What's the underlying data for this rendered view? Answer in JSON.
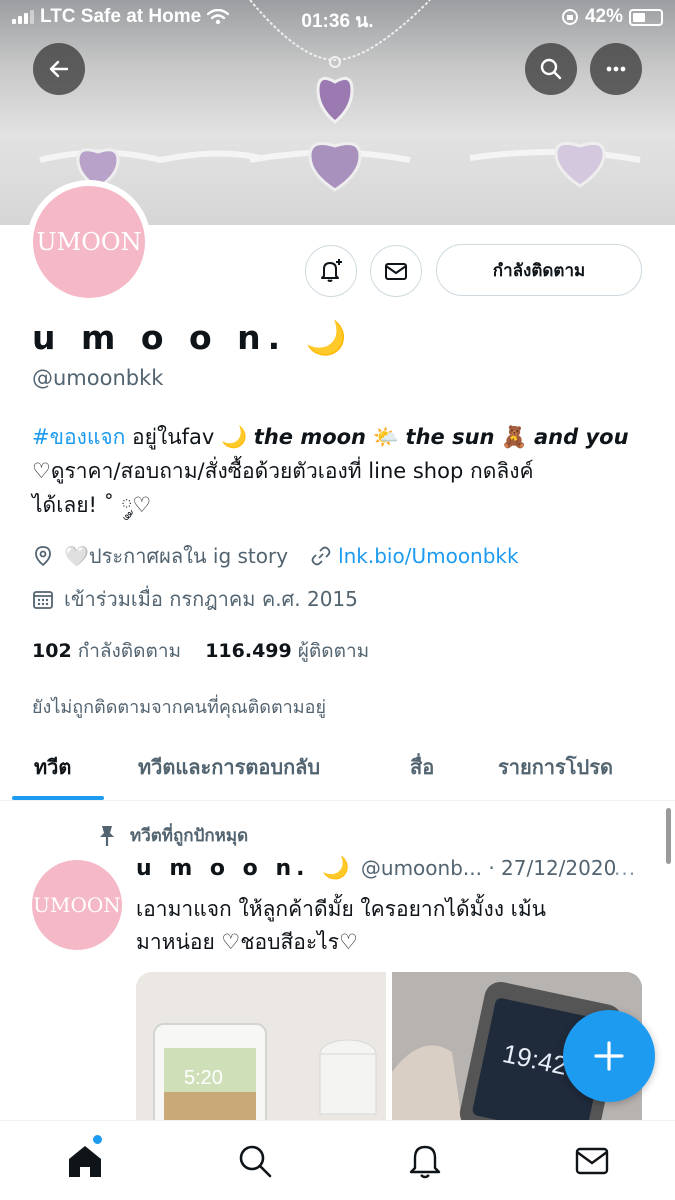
{
  "status_bar": {
    "carrier": "LTC Safe at Home",
    "time": "01:36 น.",
    "battery": "42%"
  },
  "profile": {
    "avatar_text": "UMOON",
    "name": "u m o o n. 🌙",
    "handle": "@umoonbkk",
    "follow_button": "กำลังติดตาม",
    "bio": {
      "hashtag": "#ของแจก",
      "line1_rest": " อยู่ในfav 🌙",
      "italic1": "the moon",
      "sun": " 🌤️",
      "italic2": "the sun",
      "bear": " 🧸",
      "italic3": "and you",
      "line2": "♡ดูราคา/สอบถาม/สั่งซื้อด้วยตัวเองที่ line shop กดลิงค์",
      "line3": "ได้เลย! ˚ ༘♡"
    },
    "location": "🤍ประกาศผลใน ig story",
    "website": "lnk.bio/Umoonbkk",
    "joined": "เข้าร่วมเมื่อ กรกฎาคม ค.ศ. 2015",
    "following_count": "102",
    "following_label": "กำลังติดตาม",
    "followers_count": "116.499",
    "followers_label": "ผู้ติดตาม",
    "not_followed_note": "ยังไม่ถูกติดตามจากคนที่คุณติดตามอยู่"
  },
  "tabs": [
    {
      "label": "ทวีต"
    },
    {
      "label": "ทวีตและการตอบกลับ"
    },
    {
      "label": "สื่อ"
    },
    {
      "label": "รายการโปรด"
    }
  ],
  "tweet": {
    "pinned_label": "ทวีตที่ถูกปักหมุด",
    "name": "u m o o n. 🌙",
    "handle_date": "@umoonb... · 27/12/2020",
    "more": "···",
    "text_line1": "เอามาแจก ให้ลูกค้าดีมั้ย ใครอยากได้มั้งง เม้น",
    "text_line2": "มาหน่อย ♡ชอบสีอะไร♡",
    "media1_time": "5:20",
    "media2_time": "19:42"
  },
  "colors": {
    "accent": "#1d9bf0",
    "avatar_pink": "#f5b8c7"
  }
}
